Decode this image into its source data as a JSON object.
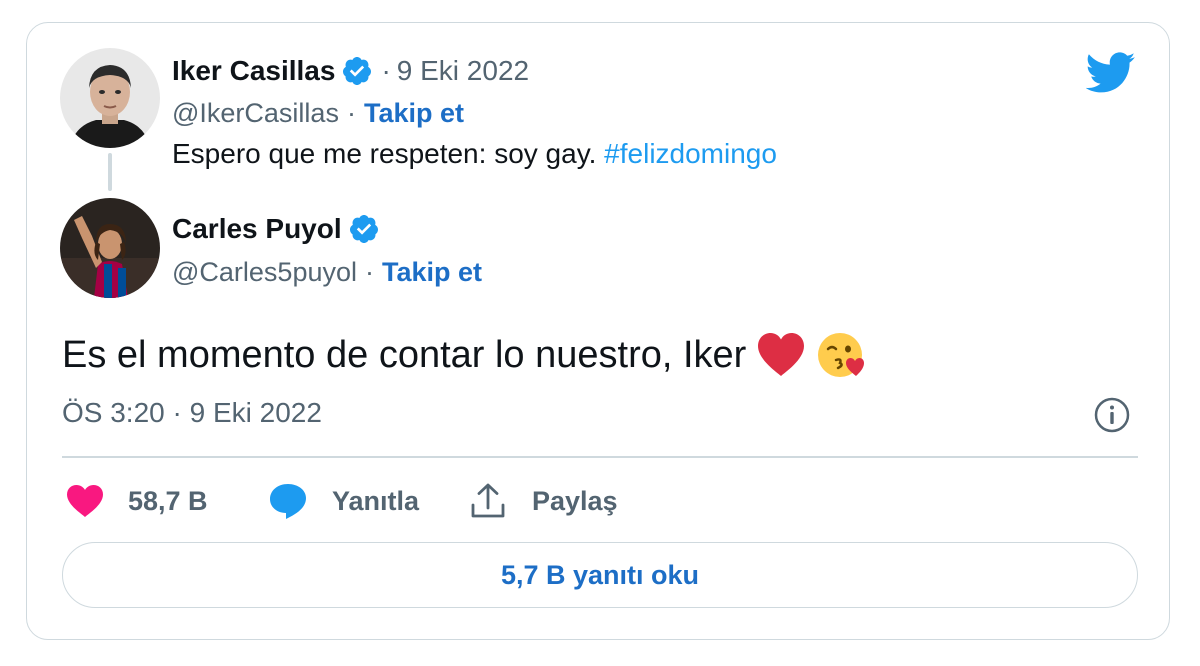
{
  "quoted_tweet": {
    "display_name": "Iker Casillas",
    "verified": true,
    "date": "9 Eki 2022",
    "handle": "@IkerCasillas",
    "follow_label": "Takip et",
    "text": "Espero que me respeten: soy gay. ",
    "hashtag": "#felizdomingo"
  },
  "reply_tweet": {
    "display_name": "Carles Puyol",
    "verified": true,
    "handle": "@Carles5puyol",
    "follow_label": "Takip et",
    "text": "Es el momento de contar lo nuestro, Iker",
    "emojis": [
      "red-heart-icon",
      "kissing-face-icon"
    ],
    "timestamp": "ÖS 3:20 · 9 Eki 2022"
  },
  "actions": {
    "likes": "58,7 B",
    "reply_label": "Yanıtla",
    "share_label": "Paylaş"
  },
  "read_replies_label": "5,7 B yanıtı oku",
  "colors": {
    "accent": "#1d9bf0",
    "link": "#1d6ec6",
    "like": "#f91880",
    "muted": "#536471",
    "border": "#cfd9de"
  }
}
